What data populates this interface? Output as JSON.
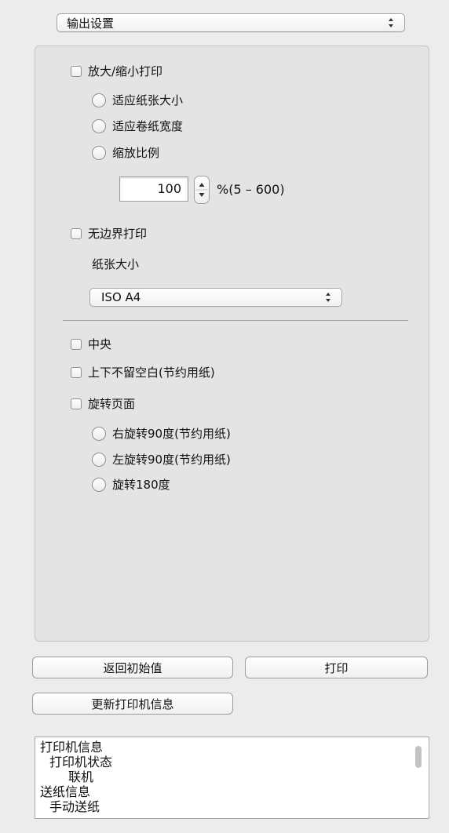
{
  "header": {
    "section_select": {
      "value": "输出设置"
    }
  },
  "scaling": {
    "checkbox_label": "放大/缩小打印",
    "radios": [
      {
        "label": "适应纸张大小"
      },
      {
        "label": "适应卷纸宽度"
      },
      {
        "label": "缩放比例"
      }
    ],
    "scale_value": "100",
    "scale_range": "%(5 – 600)"
  },
  "borderless": {
    "checkbox_label": "无边界打印",
    "paper_size_label": "纸张大小",
    "paper_size_value": "ISO A4"
  },
  "layout": {
    "center_label": "中央",
    "no_margin_label": "上下不留空白(节约用纸)",
    "rotate_label": "旋转页面",
    "rotate_radios": [
      {
        "label": "右旋转90度(节约用纸)"
      },
      {
        "label": "左旋转90度(节约用纸)"
      },
      {
        "label": "旋转180度"
      }
    ]
  },
  "buttons": {
    "reset": "返回初始值",
    "print": "打印",
    "update_printer_info": "更新打印机信息"
  },
  "info_list": {
    "lines": [
      {
        "text": "打印机信息",
        "indent": 0
      },
      {
        "text": "打印机状态",
        "indent": 1
      },
      {
        "text": "联机",
        "indent": 2
      },
      {
        "text": "送纸信息",
        "indent": 0
      },
      {
        "text": "手动送纸",
        "indent": 1
      }
    ]
  },
  "icons": {
    "popup_arrows": "up-down-arrows-icon",
    "stepper": "stepper-arrows-icon"
  }
}
